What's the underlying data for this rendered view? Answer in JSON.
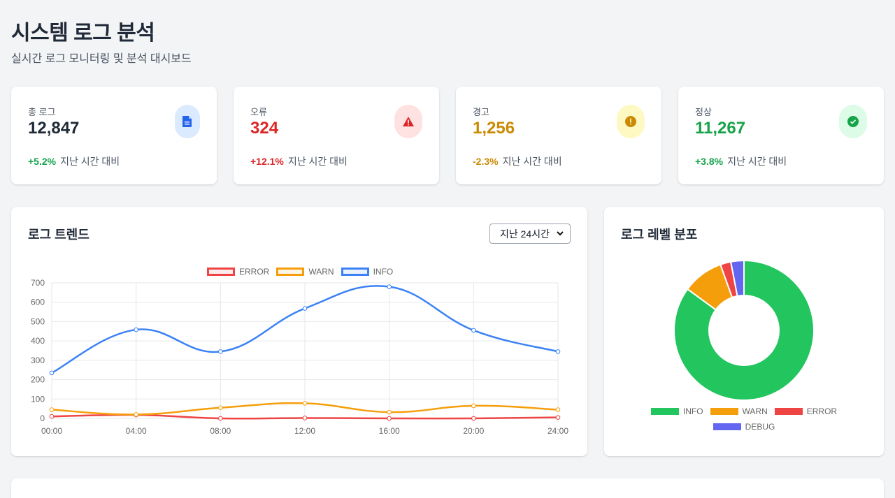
{
  "header": {
    "title": "시스템 로그 분석",
    "subtitle": "실시간 로그 모니터링 및 분석 대시보드"
  },
  "stats": [
    {
      "label": "총 로그",
      "value": "12,847",
      "change": "+5.2%",
      "compare": "지난 시간 대비",
      "value_color": "#1f2937",
      "change_color": "#16a34a",
      "icon": "document-icon",
      "icon_bg": "#dbeafe",
      "icon_color": "#2563eb"
    },
    {
      "label": "오류",
      "value": "324",
      "change": "+12.1%",
      "compare": "지난 시간 대비",
      "value_color": "#dc2626",
      "change_color": "#dc2626",
      "icon": "warning-triangle-icon",
      "icon_bg": "#fee2e2",
      "icon_color": "#dc2626"
    },
    {
      "label": "경고",
      "value": "1,256",
      "change": "-2.3%",
      "compare": "지난 시간 대비",
      "value_color": "#ca8a04",
      "change_color": "#ca8a04",
      "icon": "exclamation-circle-icon",
      "icon_bg": "#fef9c3",
      "icon_color": "#ca8a04"
    },
    {
      "label": "정상",
      "value": "11,267",
      "change": "+3.8%",
      "compare": "지난 시간 대비",
      "value_color": "#16a34a",
      "change_color": "#16a34a",
      "icon": "check-circle-icon",
      "icon_bg": "#dcfce7",
      "icon_color": "#16a34a"
    }
  ],
  "trend": {
    "title": "로그 트렌드",
    "range_selected": "지난 24시간"
  },
  "distribution": {
    "title": "로그 레벨 분포"
  },
  "chart_data": [
    {
      "type": "line",
      "x": [
        "00:00",
        "04:00",
        "08:00",
        "12:00",
        "16:00",
        "20:00",
        "24:00"
      ],
      "ylim": [
        0,
        700
      ],
      "yticks": [
        0,
        100,
        200,
        300,
        400,
        500,
        600,
        700
      ],
      "grid": true,
      "legend_position": "top",
      "series": [
        {
          "name": "ERROR",
          "color": "#ef4444",
          "values": [
            10,
            18,
            0,
            2,
            0,
            0,
            5
          ]
        },
        {
          "name": "WARN",
          "color": "#f59e0b",
          "values": [
            45,
            20,
            55,
            78,
            32,
            65,
            45
          ]
        },
        {
          "name": "INFO",
          "color": "#3b82f6",
          "values": [
            235,
            458,
            345,
            568,
            680,
            455,
            345
          ]
        }
      ]
    },
    {
      "type": "pie",
      "donut": true,
      "legend_position": "bottom",
      "labels": [
        "INFO",
        "WARN",
        "ERROR",
        "DEBUG"
      ],
      "colors": [
        "#22c55e",
        "#f59e0b",
        "#ef4444",
        "#6366f1"
      ],
      "values": [
        11267,
        1256,
        324,
        400
      ]
    }
  ]
}
